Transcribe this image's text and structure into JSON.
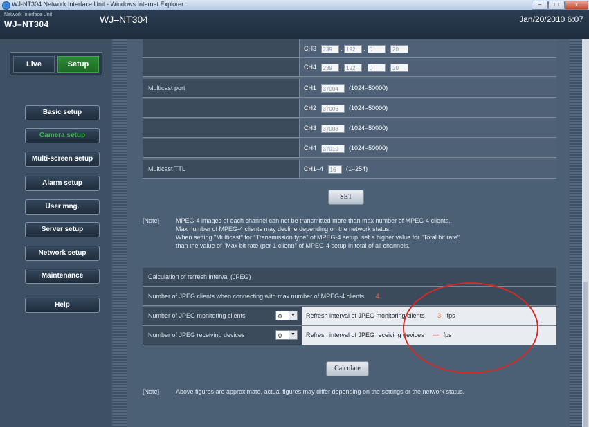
{
  "window": {
    "title": "WJ-NT304 Network Interface Unit - Windows Internet Explorer",
    "min_label": "–",
    "max_label": "□",
    "close_label": "x"
  },
  "header": {
    "brand_small": "Network Interface Unit",
    "brand_big": "WJ–NT304",
    "model": "WJ–NT304",
    "datetime": "Jan/20/2010  6:07"
  },
  "sidebar": {
    "live": "Live",
    "setup": "Setup",
    "items": [
      {
        "label": "Basic setup"
      },
      {
        "label": "Camera setup"
      },
      {
        "label": "Multi-screen setup"
      },
      {
        "label": "Alarm setup"
      },
      {
        "label": "User mng."
      },
      {
        "label": "Server setup"
      },
      {
        "label": "Network setup"
      },
      {
        "label": "Maintenance"
      },
      {
        "label": "Help"
      }
    ]
  },
  "multicast_address": {
    "rows": [
      {
        "ch": "CH3",
        "octets": [
          "239",
          "192",
          "0",
          "20"
        ]
      },
      {
        "ch": "CH4",
        "octets": [
          "239",
          "192",
          "0",
          "20"
        ]
      }
    ]
  },
  "multicast_port": {
    "label": "Multicast port",
    "range": "(1024–50000)",
    "rows": [
      {
        "ch": "CH1",
        "value": "37004"
      },
      {
        "ch": "CH2",
        "value": "37006"
      },
      {
        "ch": "CH3",
        "value": "37008"
      },
      {
        "ch": "CH4",
        "value": "37010"
      }
    ]
  },
  "multicast_ttl": {
    "label": "Multicast TTL",
    "ch": "CH1–4",
    "value": "16",
    "range": "(1–254)"
  },
  "set_button": "SET",
  "note1": {
    "tag": "[Note]",
    "lines": [
      "MPEG-4 images of each channel can not be transmitted more than max number of MPEG-4 clients.",
      "Max number of MPEG-4 clients may decline depending on the network status.",
      "When setting \"Multicast\" for \"Transmission type\" of MPEG-4 setup, set a higher value for \"Total bit rate\"",
      "than the value of \"Max bit rate (per 1 client)\" of MPEG-4 setup in total of all channels."
    ]
  },
  "jpeg": {
    "header": "Calculation of refresh interval (JPEG)",
    "clients_label": "Number of JPEG clients when connecting with max number of MPEG-4 clients",
    "clients_value": "4",
    "monitoring_label": "Number of JPEG monitoring clients",
    "monitoring_select": "0",
    "monitoring_result_label": "Refresh interval of JPEG monitoring clients",
    "monitoring_result_value": "3",
    "receiving_label": "Number of JPEG receiving devices",
    "receiving_select": "0",
    "receiving_result_label": "Refresh interval of JPEG receiving devices",
    "receiving_result_value": "---",
    "unit": "fps"
  },
  "calculate_button": "Calculate",
  "note2": {
    "tag": "[Note]",
    "text": "Above figures are approximate, actual figures may differ depending on the settings or the network status."
  },
  "colors": {
    "active_nav": "#33c13f",
    "setup_mode": "#1c6a24",
    "annotation_circle": "#d22a24"
  }
}
